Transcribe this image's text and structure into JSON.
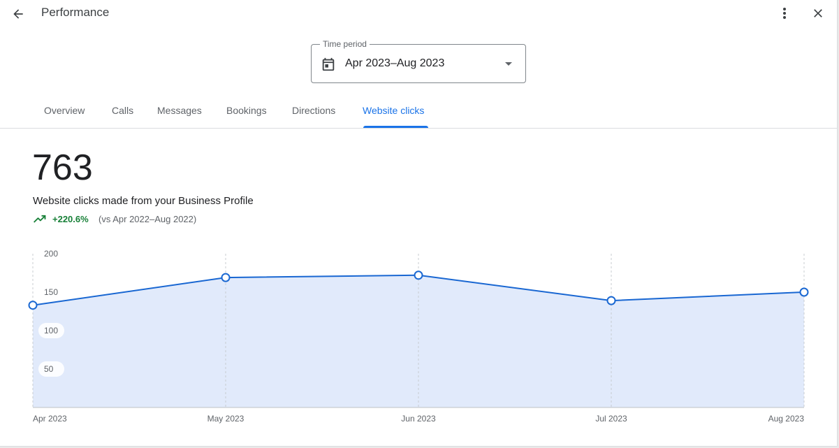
{
  "header": {
    "title": "Performance",
    "back_icon": "arrow-back-icon",
    "more_icon": "more-vert-icon",
    "close_icon": "close-icon"
  },
  "time_period": {
    "label": "Time period",
    "value": "Apr 2023–Aug 2023",
    "icon": "calendar-icon"
  },
  "tabs": [
    {
      "label": "Overview",
      "active": false
    },
    {
      "label": "Calls",
      "active": false
    },
    {
      "label": "Messages",
      "active": false
    },
    {
      "label": "Bookings",
      "active": false
    },
    {
      "label": "Directions",
      "active": false
    },
    {
      "label": "Website clicks",
      "active": true
    }
  ],
  "summary": {
    "total": "763",
    "description": "Website clicks made from your Business Profile",
    "change": "+220.6%",
    "comparison": "(vs Apr 2022–Aug 2022)",
    "trend_icon": "trending-up-icon"
  },
  "colors": {
    "accent": "#1a73e8",
    "line": "#1967d2",
    "area_fill": "#e1eafb",
    "positive": "#188038"
  },
  "chart_data": {
    "type": "area",
    "categories": [
      "Apr 2023",
      "May 2023",
      "Jun 2023",
      "Jul 2023",
      "Aug 2023"
    ],
    "series": [
      {
        "values": [
          133,
          169,
          172,
          139,
          150
        ]
      }
    ],
    "yticks": [
      "200",
      "150",
      "100",
      "50"
    ],
    "ylim": [
      0,
      200
    ],
    "grid": "vertical dashed"
  }
}
